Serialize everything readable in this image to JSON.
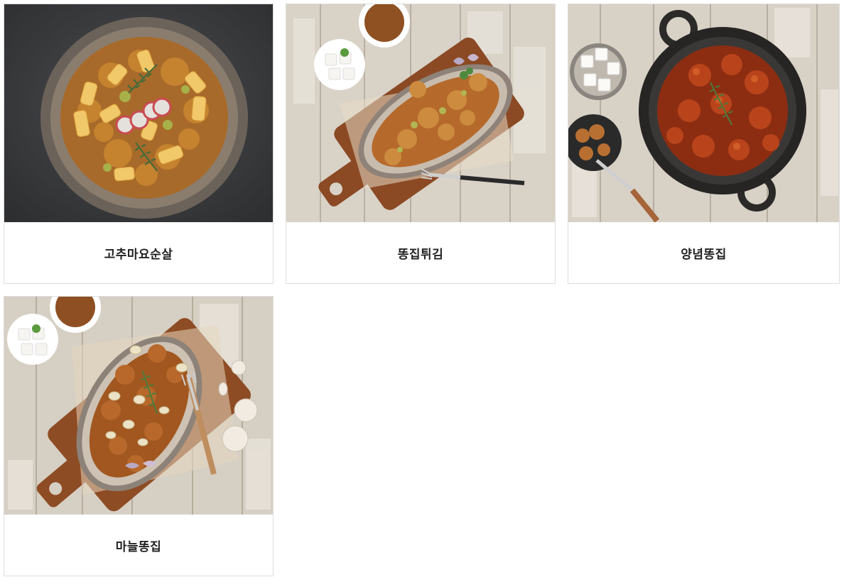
{
  "menu": {
    "items": [
      {
        "name": "고추마요순살"
      },
      {
        "name": "똥집튀김"
      },
      {
        "name": "양념똥집"
      },
      {
        "name": "마늘똥집"
      }
    ]
  },
  "colors": {
    "card_border": "#dddddd",
    "caption_text": "#222222",
    "slate_background": "#3a3b3d",
    "wood_background": "#d9d2c7"
  }
}
